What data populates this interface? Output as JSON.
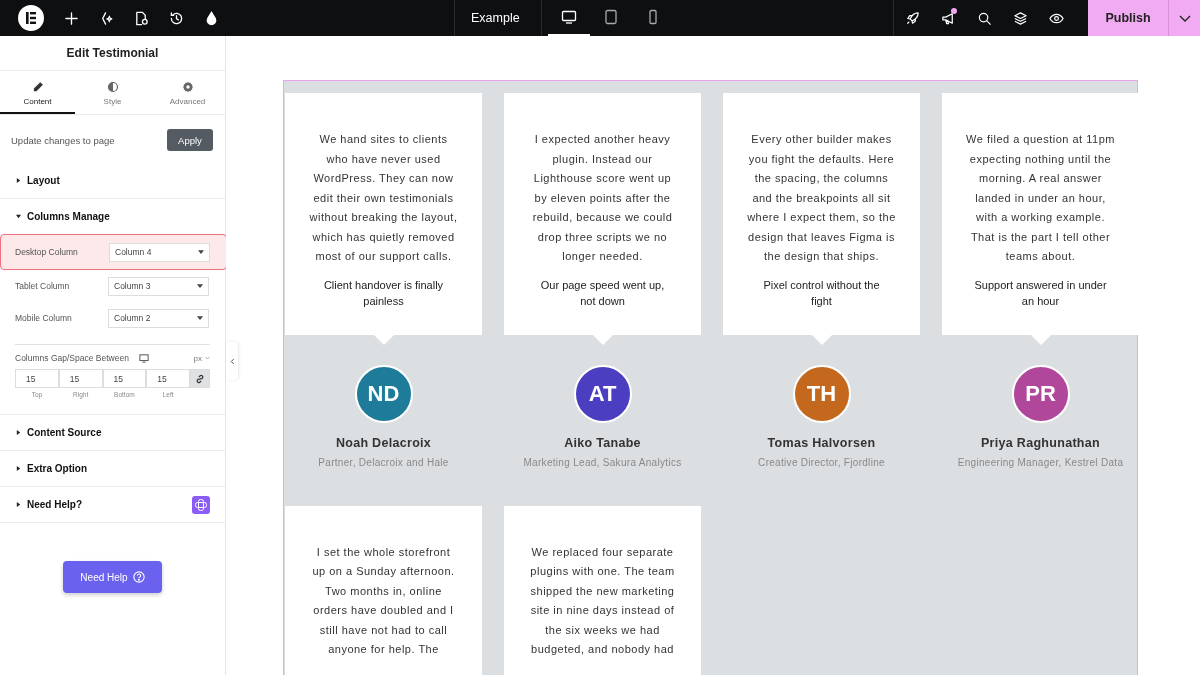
{
  "topbar": {
    "left_tools": [
      {
        "kind": "plus"
      },
      {
        "kind": "sparkle"
      },
      {
        "kind": "page"
      },
      {
        "kind": "history"
      },
      {
        "kind": "drop"
      }
    ],
    "page_selector": "Example",
    "devices": [
      {
        "kind": "desktop",
        "selected": true
      },
      {
        "kind": "tablet",
        "selected": false
      },
      {
        "kind": "mobile",
        "selected": false
      }
    ],
    "right_tools": [
      {
        "kind": "rocket",
        "notification": false
      },
      {
        "kind": "megaphone",
        "notification": true
      },
      {
        "kind": "search",
        "notification": false
      },
      {
        "kind": "layers",
        "notification": false
      },
      {
        "kind": "eye",
        "notification": false
      }
    ],
    "publish": "Publish"
  },
  "panel": {
    "title": "Edit Testimonial",
    "tabs": [
      {
        "label": "Content",
        "kind": "pencil",
        "selected": true
      },
      {
        "label": "Style",
        "kind": "contrast",
        "selected": false
      },
      {
        "label": "Advanced",
        "kind": "gear",
        "selected": false
      }
    ],
    "update_text": "Update changes to page",
    "apply": "Apply",
    "sections": [
      {
        "title": "Layout",
        "expanded": false
      },
      {
        "title": "Columns Manage",
        "expanded": true,
        "fields": [
          {
            "label": "Desktop Column",
            "value": "Column 4",
            "highlighted": true
          },
          {
            "label": "Tablet Column",
            "value": "Column 3",
            "highlighted": false
          },
          {
            "label": "Mobile Column",
            "value": "Column 2",
            "highlighted": false
          }
        ],
        "gap": {
          "label": "Columns Gap/Space Between",
          "unit": "px",
          "linked": true,
          "values": [
            {
              "value": "15",
              "label": "Top"
            },
            {
              "value": "15",
              "label": "Right"
            },
            {
              "value": "15",
              "label": "Bottom"
            },
            {
              "value": "15",
              "label": "Left"
            }
          ]
        }
      },
      {
        "title": "Content Source",
        "expanded": false
      },
      {
        "title": "Extra Option",
        "expanded": false
      },
      {
        "title": "Need Help?",
        "expanded": false,
        "badge": true
      }
    ],
    "help_button": "Need Help"
  },
  "testimonials": [
    {
      "quote": "We hand sites to clients who have never used WordPress. They can now edit their own testimonials without breaking the layout, which has quietly removed most of our support calls.",
      "highlight": "Client handover is finally painless",
      "initials": "ND",
      "name": "Noah Delacroix",
      "role": "Partner, Delacroix and Hale",
      "color": "#1e7b9a"
    },
    {
      "quote": "I expected another heavy plugin. Instead our Lighthouse score went up by eleven points after the rebuild, because we could drop three scripts we no longer needed.",
      "highlight": "Our page speed went up, not down",
      "initials": "AT",
      "name": "Aiko Tanabe",
      "role": "Marketing Lead, Sakura Analytics",
      "color": "#4b3ec0"
    },
    {
      "quote": "Every other builder makes you fight the defaults. Here the spacing, the columns and the breakpoints all sit where I expect them, so the design that leaves Figma is the design that ships.",
      "highlight": "Pixel control without the fight",
      "initials": "TH",
      "name": "Tomas Halvorsen",
      "role": "Creative Director, Fjordline",
      "color": "#c4681e"
    },
    {
      "quote": "We filed a question at 11pm expecting nothing until the morning. A real answer landed in under an hour, with a working example. That is the part I tell other teams about.",
      "highlight": "Support answered in under an hour",
      "initials": "PR",
      "name": "Priya Raghunathan",
      "role": "Engineering Manager, Kestrel Data",
      "color": "#b0479b"
    },
    {
      "quote": "I set the whole storefront up on a Sunday afternoon. Two months in, online orders have doubled and I still have not had to call anyone for help. The"
    },
    {
      "quote": "We replaced four separate plugins with one. The team shipped the new marketing site in nine days instead of the six weeks we had budgeted, and nobody had"
    }
  ]
}
